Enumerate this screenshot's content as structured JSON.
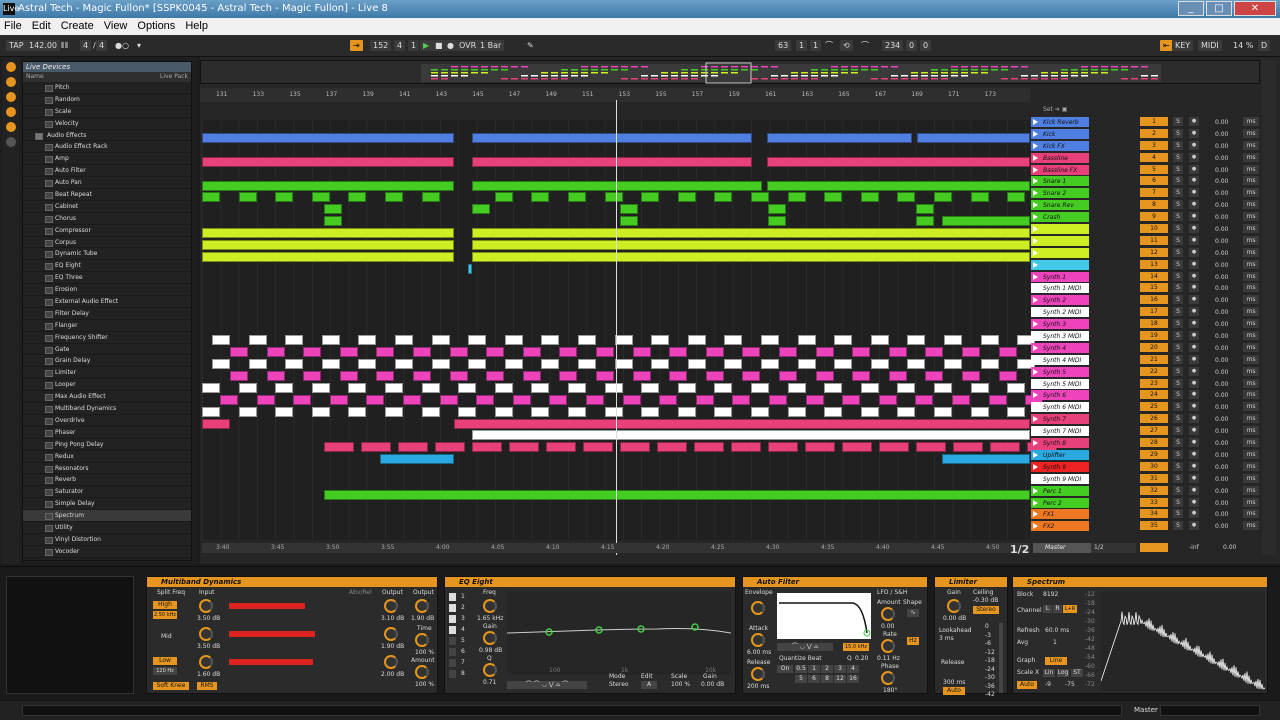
{
  "window": {
    "title": "Astral Tech - Magic Fullon*  [SSPK0045 - Astral Tech - Magic Fullon]  - Live 8",
    "app_icon": "Live",
    "buttons": [
      "_",
      "□",
      "✕"
    ]
  },
  "menu": [
    "File",
    "Edit",
    "Create",
    "View",
    "Options",
    "Help"
  ],
  "transport": {
    "tap": "TAP",
    "tempo": "142.00",
    "signature_num": "4",
    "signature_den": "4",
    "pos_bar": "152",
    "pos_beat": "4",
    "pos_sixteenth": "1",
    "ovr": "OVR",
    "quantize": "1 Bar",
    "loop_bar": "63",
    "loop_beat": "1",
    "loop_six": "1",
    "len_bar": "234",
    "len_beat": "0",
    "len_six": "0",
    "key": "KEY",
    "midi": "MIDI",
    "cpu": "14 %",
    "d": "D"
  },
  "browser": {
    "header": "Live Devices",
    "col_name": "Name",
    "col_pack": "Live Pack",
    "items": [
      {
        "label": "Pitch",
        "folder": false
      },
      {
        "label": "Random",
        "folder": false
      },
      {
        "label": "Scale",
        "folder": false
      },
      {
        "label": "Velocity",
        "folder": false
      },
      {
        "label": "Audio Effects",
        "folder": true
      },
      {
        "label": "Audio Effect Rack",
        "folder": false
      },
      {
        "label": "Amp",
        "folder": false
      },
      {
        "label": "Auto Filter",
        "folder": false
      },
      {
        "label": "Auto Pan",
        "folder": false
      },
      {
        "label": "Beat Repeat",
        "folder": false
      },
      {
        "label": "Cabinet",
        "folder": false
      },
      {
        "label": "Chorus",
        "folder": false
      },
      {
        "label": "Compressor",
        "folder": false
      },
      {
        "label": "Corpus",
        "folder": false
      },
      {
        "label": "Dynamic Tube",
        "folder": false
      },
      {
        "label": "EQ Eight",
        "folder": false
      },
      {
        "label": "EQ Three",
        "folder": false
      },
      {
        "label": "Erosion",
        "folder": false
      },
      {
        "label": "External Audio Effect",
        "folder": false
      },
      {
        "label": "Filter Delay",
        "folder": false
      },
      {
        "label": "Flanger",
        "folder": false
      },
      {
        "label": "Frequency Shifter",
        "folder": false
      },
      {
        "label": "Gate",
        "folder": false
      },
      {
        "label": "Grain Delay",
        "folder": false
      },
      {
        "label": "Limiter",
        "folder": false
      },
      {
        "label": "Looper",
        "folder": false
      },
      {
        "label": "Max Audio Effect",
        "folder": false
      },
      {
        "label": "Multiband Dynamics",
        "folder": false
      },
      {
        "label": "Overdrive",
        "folder": false
      },
      {
        "label": "Phaser",
        "folder": false
      },
      {
        "label": "Ping Pong Delay",
        "folder": false
      },
      {
        "label": "Redux",
        "folder": false
      },
      {
        "label": "Resonators",
        "folder": false
      },
      {
        "label": "Reverb",
        "folder": false
      },
      {
        "label": "Saturator",
        "folder": false
      },
      {
        "label": "Simple Delay",
        "folder": false
      },
      {
        "label": "Spectrum",
        "folder": false,
        "selected": true
      },
      {
        "label": "Utility",
        "folder": false
      },
      {
        "label": "Vinyl Distortion",
        "folder": false
      },
      {
        "label": "Vocoder",
        "folder": false
      }
    ]
  },
  "ruler": [
    "131",
    "133",
    "135",
    "137",
    "139",
    "141",
    "143",
    "145",
    "147",
    "149",
    "151",
    "153",
    "155",
    "157",
    "159",
    "161",
    "163",
    "165",
    "167",
    "169",
    "171",
    "173"
  ],
  "timebar": [
    "3:40",
    "3:45",
    "3:50",
    "3:55",
    "4:00",
    "4:05",
    "4:10",
    "4:15",
    "4:20",
    "4:25",
    "4:30",
    "4:35",
    "4:40",
    "4:45",
    "4:50"
  ],
  "set_header": "Set",
  "page_indicator": "1/2",
  "tracks": [
    {
      "name": "Kick Reverb",
      "num": "1",
      "color": "#4f7fe0",
      "vol": "0.00"
    },
    {
      "name": "Kick",
      "num": "2",
      "color": "#4f7fe0",
      "vol": "0.00"
    },
    {
      "name": "Kick FX",
      "num": "3",
      "color": "#4f7fe0",
      "vol": "0.00"
    },
    {
      "name": "Bassline",
      "num": "4",
      "color": "#e8407a",
      "vol": "0.00"
    },
    {
      "name": "Bassline FX",
      "num": "5",
      "color": "#e8407a",
      "vol": "0.00"
    },
    {
      "name": "Snare 1",
      "num": "6",
      "color": "#44cc22",
      "vol": "0.00"
    },
    {
      "name": "Snare 2",
      "num": "7",
      "color": "#44cc22",
      "vol": "0.00"
    },
    {
      "name": "Snare Rev",
      "num": "8",
      "color": "#44cc22",
      "vol": "0.00"
    },
    {
      "name": "Crash",
      "num": "9",
      "color": "#44cc22",
      "vol": "0.00"
    },
    {
      "name": "",
      "num": "10",
      "color": "#ccee22",
      "vol": "0.00"
    },
    {
      "name": "",
      "num": "11",
      "color": "#ccee22",
      "vol": "0.00"
    },
    {
      "name": "",
      "num": "12",
      "color": "#ccee22",
      "vol": "0.00"
    },
    {
      "name": "",
      "num": "13",
      "color": "#44c8e8",
      "vol": "0.00"
    },
    {
      "name": "Synth 1",
      "num": "14",
      "color": "#ee44bb",
      "vol": "0.00"
    },
    {
      "name": "Synth 1 MIDI",
      "num": "15",
      "color": "#ffffff",
      "vol": "0.00"
    },
    {
      "name": "Synth 2",
      "num": "16",
      "color": "#ee44bb",
      "vol": "0.00"
    },
    {
      "name": "Synth 2 MIDI",
      "num": "17",
      "color": "#ffffff",
      "vol": "0.00"
    },
    {
      "name": "Synth 3",
      "num": "18",
      "color": "#ee44bb",
      "vol": "0.00"
    },
    {
      "name": "Synth 3 MIDI",
      "num": "19",
      "color": "#ffffff",
      "vol": "0.00"
    },
    {
      "name": "Synth 4",
      "num": "20",
      "color": "#ee44bb",
      "vol": "0.00"
    },
    {
      "name": "Synth 4 MIDI",
      "num": "21",
      "color": "#ffffff",
      "vol": "0.00"
    },
    {
      "name": "Synth 5",
      "num": "22",
      "color": "#ee44bb",
      "vol": "0.00"
    },
    {
      "name": "Synth 5 MIDI",
      "num": "23",
      "color": "#ffffff",
      "vol": "0.00"
    },
    {
      "name": "Synth 6",
      "num": "24",
      "color": "#ee44bb",
      "vol": "0.00"
    },
    {
      "name": "Synth 6 MIDI",
      "num": "25",
      "color": "#ffffff",
      "vol": "0.00"
    },
    {
      "name": "Synth 7",
      "num": "26",
      "color": "#e8407a",
      "vol": "0.00"
    },
    {
      "name": "Synth 7 MIDI",
      "num": "27",
      "color": "#ffffff",
      "vol": "0.00"
    },
    {
      "name": "Synth 8",
      "num": "28",
      "color": "#e8407a",
      "vol": "0.00"
    },
    {
      "name": "Uplifter",
      "num": "29",
      "color": "#2aa8e0",
      "vol": "0.00"
    },
    {
      "name": "Synth 9",
      "num": "30",
      "color": "#ee2222",
      "vol": "0.00"
    },
    {
      "name": "Synth 9 MIDI",
      "num": "31",
      "color": "#ffffff",
      "vol": "0.00"
    },
    {
      "name": "Perc 1",
      "num": "32",
      "color": "#44cc22",
      "vol": "0.00"
    },
    {
      "name": "Perc 2",
      "num": "33",
      "color": "#44cc22",
      "vol": "0.00"
    },
    {
      "name": "FX1",
      "num": "34",
      "color": "#ee7722",
      "vol": "0.00"
    },
    {
      "name": "FX2",
      "num": "35",
      "color": "#ee7722",
      "vol": "0.00"
    }
  ],
  "track_labels": {
    "solo": "S",
    "ms": "ms"
  },
  "master": {
    "name": "Master",
    "io": "1/2",
    "vol": "-inf",
    "vol2": "0.00"
  },
  "devices": {
    "multiband": {
      "title": "Multiband Dynamics",
      "split_freq": "Split Freq",
      "input": "Input",
      "output": "Output",
      "high": "High",
      "mid": "Mid",
      "low": "Low",
      "freq_high": "2.50 kHz",
      "freq_low": "120 Hz",
      "input_high": "3.50 dB",
      "input_mid": "3.50 dB",
      "input_low": "1.60 dB",
      "out_high": "3.10 dB",
      "out_mid": "1.90 dB",
      "out_low": "2.00 dB",
      "output_val": "1.90 dB",
      "time": "Time",
      "time_val": "100 %",
      "amount": "Amount",
      "amount_val": "100 %",
      "soft_knee": "Soft Knee",
      "rms": "RMS",
      "abv_rel": "Abv/Rel"
    },
    "eq": {
      "title": "EQ Eight",
      "freq": "Freq",
      "freq_val": "1.65 kHz",
      "gain": "Gain",
      "gain_val": "0.98 dB",
      "q": "Q",
      "q_val": "0.71",
      "bands": [
        "1",
        "2",
        "3",
        "4",
        "5",
        "6",
        "7",
        "8"
      ],
      "mode": "Mode",
      "mode_val": "Stereo",
      "edit": "Edit",
      "edit_val": "A",
      "scale": "Scale",
      "scale_val": "100 %",
      "out_gain": "Gain",
      "out_gain_val": "0.00 dB",
      "axis": [
        "100",
        "1k",
        "10k"
      ]
    },
    "autofilter": {
      "title": "Auto Filter",
      "envelope": "Envelope",
      "attack": "Attack",
      "attack_val": "6.00 ms",
      "release": "Release",
      "release_val": "200 ms",
      "lfo": "LFO / S&H",
      "amount": "Amount",
      "amount_val": "0.00",
      "shape": "Shape",
      "rate": "Rate",
      "rate_val": "0.11 Hz",
      "phase": "Phase",
      "phase_val": "180°",
      "quantize": "Quantize Beat",
      "on": "On",
      "qvals": [
        "0.5",
        "1",
        "2",
        "3",
        "4",
        "5",
        "6",
        "8",
        "12",
        "16"
      ],
      "q": "Q",
      "q_val": "0.20",
      "freq_val": "15.0 kHz"
    },
    "limiter": {
      "title": "Limiter",
      "gain": "Gain",
      "gain_val": "0.00 dB",
      "ceiling": "Ceiling",
      "ceiling_val": "-0.30 dB",
      "stereo": "Stereo",
      "lookahead": "Lookahead",
      "lookahead_val": "3 ms",
      "release": "Release",
      "release_val": "300 ms",
      "auto": "Auto",
      "scale": [
        "0",
        "-3",
        "-6",
        "-12",
        "-18",
        "-24",
        "-30",
        "-36",
        "-42"
      ]
    },
    "spectrum": {
      "title": "Spectrum",
      "block": "Block",
      "block_val": "8192",
      "channel": "Channel",
      "ch_l": "L",
      "ch_r": "R",
      "ch_lr": "L+R",
      "refresh": "Refresh",
      "refresh_val": "60.0 ms",
      "avg": "Avg",
      "avg_val": "1",
      "graph": "Graph",
      "graph_val": "Line",
      "scale_x": "Scale X",
      "lin": "Lin",
      "log": "Log",
      "st": "ST",
      "auto": "Auto",
      "range_a": "-9",
      "range_b": "-75",
      "db_axis": [
        "-12",
        "-18",
        "-24",
        "-30",
        "-36",
        "-42",
        "-48",
        "-54",
        "-60",
        "-66",
        "-72"
      ]
    }
  },
  "status": {
    "master": "Master"
  }
}
